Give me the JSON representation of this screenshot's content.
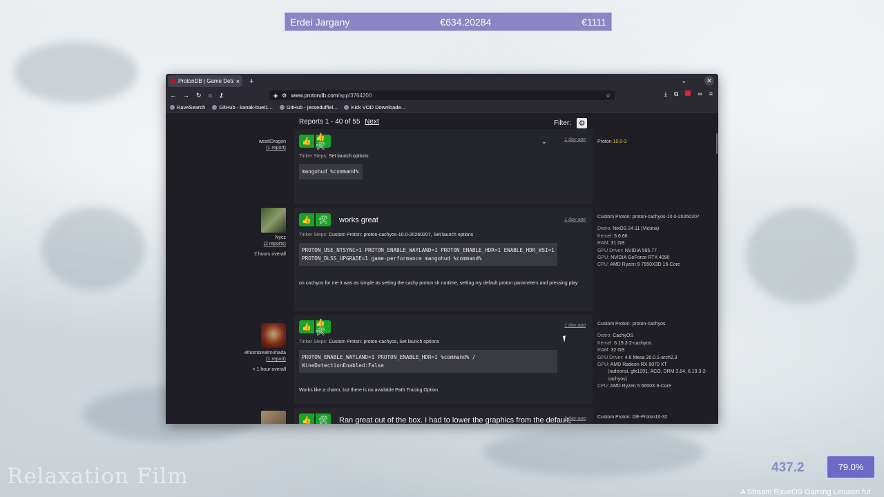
{
  "ticker": {
    "name": "Erdei Jargany",
    "amount": "€634.20284",
    "goal": "€1111"
  },
  "browser": {
    "tab_title": "ProtonDB | Game Detail",
    "tab_close": "×",
    "new_tab": "+",
    "url_host": "www.protondb.com",
    "url_path": "/app/3764200",
    "bookmarks": [
      {
        "label": "RaveSearch"
      },
      {
        "label": "GitHub - kanak-buet1..."
      },
      {
        "label": "GitHub - jesseduffiel..."
      },
      {
        "label": "Kick VOD Downloade..."
      }
    ]
  },
  "page": {
    "reports_label": "Reports 1 - 40 of 55",
    "next_label": "Next",
    "filter_label": "Filter:"
  },
  "reports": [
    {
      "username": "westIDragon",
      "report_count": "(1 report)",
      "playtime": "",
      "title": "",
      "date": "1 day ago",
      "tinker_label": "Tinker Steps:",
      "tinker_steps": "Set launch options",
      "code": "mangohud %command%",
      "note": "",
      "system": {
        "proton_prefix": "Proton",
        "proton_version": "10.0-3"
      }
    },
    {
      "username": "Nycz",
      "report_count": "(2 reports)",
      "playtime": "2 hours overall",
      "title": "works great",
      "date": "1 day ago",
      "tinker_label": "Tinker Steps:",
      "tinker_steps": "Custom Proton: proton-cachyos-10.0-20260207, Set launch options",
      "code": "PROTON_USE_NTSYNC=1 PROTON_ENABLE_WAYLAND=1 PROTON_ENABLE_HDR=1 ENABLE_HDR_WSI=1 PROTON_DLSS_UPGRADE=1 game-performance mangohud %command%",
      "note": "on cachyos for me it was as simple as setting the cachy proton slr runtime, setting my default proton parameters and pressing play",
      "system": {
        "custom_proton": "Custom Proton: proton-cachyos-10.0-20260207",
        "distro_label": "Distro:",
        "distro": "NixOS 24.11 (Vicuna)",
        "kernel_label": "Kernel:",
        "kernel": "6.6.66",
        "ram_label": "RAM:",
        "ram": "31 GB",
        "gpu_driver_label": "GPU Driver:",
        "gpu_driver": "NVIDIA 565.77",
        "gpu_label": "GPU:",
        "gpu": "NVIDIA GeForce RTX 4090",
        "cpu_label": "CPU:",
        "cpu": "AMD Ryzen 9 7950X3D 16-Core"
      }
    },
    {
      "username": "elhombrealmohada",
      "report_count": "(1 report)",
      "playtime": "< 1 hour overall",
      "title": "",
      "date": "1 day ago",
      "tinker_label": "Tinker Steps:",
      "tinker_steps": "Custom Proton: proton-cachyos, Set launch options",
      "code": "PROTON_ENABLE_WAYLAND=1 PROTON_ENABLE_HDR=1 %command% / WineDetectionEnabled:False",
      "note": "Works like a charm, but there is no available Path Tracing Option.",
      "system": {
        "custom_proton": "Custom Proton: proton-cachyos",
        "distro_label": "Distro:",
        "distro": "CachyOS",
        "kernel_label": "Kernel:",
        "kernel": "6.19.3-2-cachyos",
        "ram_label": "RAM:",
        "ram": "32 GB",
        "gpu_driver_label": "GPU Driver:",
        "gpu_driver": "4.6 Mesa 26.0.1-arch2.3",
        "gpu_label": "GPU:",
        "gpu": "AMD Radeon RX 9070 XT",
        "gpu_extra": "(radeonsi, gfx1201, ACO, DRM 3.64, 6.19.3-2-cachyos)",
        "cpu_label": "CPU:",
        "cpu": "AMD Ryzen 5 5600X 6-Core"
      }
    },
    {
      "title": "Ran great out of the box. I had to lower the graphics from the default,",
      "date": "1 day ago",
      "system": {
        "custom_proton": "Custom Proton: GE-Proton10-32"
      }
    }
  ],
  "overlay": {
    "watermark_left": "Relaxation Film",
    "counter": "437.2",
    "percent": "79.0%",
    "stream_text": "A Stream RaveOS Gaming Linuxon fut"
  },
  "colors": {
    "rating_green": "#1aa32b",
    "proton_yellow": "#d8c233",
    "ticker_bg": "#8c84c4"
  }
}
